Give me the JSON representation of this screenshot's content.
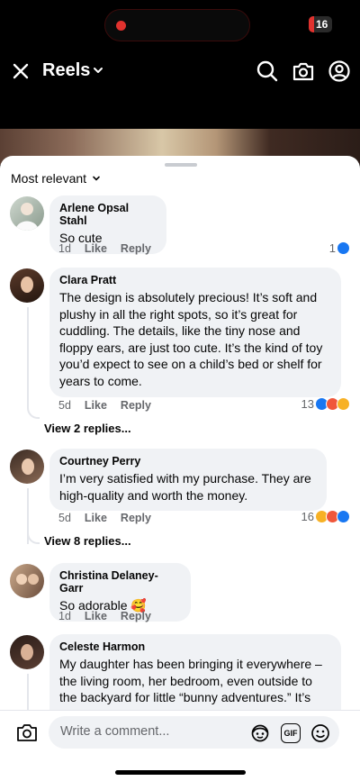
{
  "status_bar": {
    "battery": "16"
  },
  "header": {
    "title": "Reels"
  },
  "sheet": {
    "sort_label": "Most relevant",
    "comments": [
      {
        "name": "Arlene Opsal Stahl",
        "text": "So cute",
        "time": "1d",
        "like": "Like",
        "reply": "Reply",
        "reaction_count": "1"
      },
      {
        "name": "Clara Pratt",
        "text": "The design is absolutely precious! It’s soft and plushy in all the right spots, so it’s great for cuddling. The details, like the tiny nose and floppy ears, are just too cute. It’s the kind of toy you’d expect to see on a child’s bed or shelf for years to come.",
        "time": "5d",
        "like": "Like",
        "reply": "Reply",
        "reaction_count": "13",
        "view_replies": "View 2 replies..."
      },
      {
        "name": "Courtney Perry",
        "text": "I’m very satisfied with my purchase. They are high-quality and worth the money.",
        "time": "5d",
        "like": "Like",
        "reply": "Reply",
        "reaction_count": "16",
        "view_replies": "View 8 replies..."
      },
      {
        "name": "Christina Delaney-Garr",
        "text": "So adorable 🥰",
        "time": "1d",
        "like": "Like",
        "reply": "Reply"
      },
      {
        "name": "Celeste Harmon",
        "text": "My daughter has been bringing it everywhere – the living room, her bedroom, even outside to the backyard for little “bunny adventures.” It’s"
      }
    ]
  },
  "composer": {
    "placeholder": "Write a comment...",
    "gif": "GIF"
  },
  "colors": {
    "like_blue": "#1877f2",
    "bubble_bg": "#f0f2f5",
    "meta_gray": "#65676b",
    "status_red": "#e0322e"
  }
}
